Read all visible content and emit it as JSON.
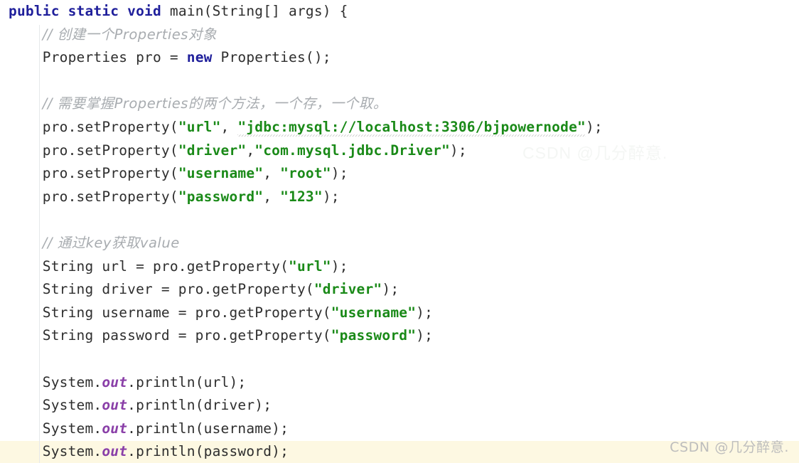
{
  "editor": {
    "language": "java",
    "background_color": "#ffffff",
    "highlight_color": "#fdf8e2",
    "indent_guide_color": "#e6e8ea",
    "colors": {
      "keyword": "#1f1f9b",
      "string": "#1a8a18",
      "comment": "#a8acb0",
      "static_field": "#8a3fa8",
      "plain_text": "#2e2e2e",
      "squiggle": "#cfcfcf"
    },
    "highlighted_line_number": 18
  },
  "code_lines": [
    {
      "id": "line-1",
      "highlighted": false,
      "tokens": [
        {
          "cls": "kw",
          "text": "public static void "
        },
        {
          "cls": "plain",
          "text": "main(String[] args) {"
        }
      ]
    },
    {
      "id": "line-2",
      "highlighted": false,
      "tokens": [
        {
          "cls": "plain",
          "text": "    "
        },
        {
          "cls": "cmt",
          "text": "// 创建一个Properties对象"
        }
      ]
    },
    {
      "id": "line-3",
      "highlighted": false,
      "tokens": [
        {
          "cls": "plain",
          "text": "    Properties pro = "
        },
        {
          "cls": "kw",
          "text": "new"
        },
        {
          "cls": "plain",
          "text": " Properties();"
        }
      ]
    },
    {
      "id": "line-4",
      "highlighted": false,
      "tokens": []
    },
    {
      "id": "line-5",
      "highlighted": false,
      "tokens": [
        {
          "cls": "plain",
          "text": "    "
        },
        {
          "cls": "cmt",
          "text": "// 需要掌握Properties的两个方法，一个存，一个取。"
        }
      ]
    },
    {
      "id": "line-6",
      "highlighted": false,
      "tokens": [
        {
          "cls": "plain",
          "text": "    pro.setProperty("
        },
        {
          "cls": "str",
          "text": "\"url\""
        },
        {
          "cls": "plain",
          "text": ", "
        },
        {
          "cls": "str squig",
          "text": "\"jdbc:mysql://localhost:3306/bjpowernode\""
        },
        {
          "cls": "plain",
          "text": ");"
        }
      ]
    },
    {
      "id": "line-7",
      "highlighted": false,
      "tokens": [
        {
          "cls": "plain",
          "text": "    pro.setProperty("
        },
        {
          "cls": "str",
          "text": "\"driver\""
        },
        {
          "cls": "plain",
          "text": ","
        },
        {
          "cls": "str",
          "text": "\"com.mysql.jdbc.Driver\""
        },
        {
          "cls": "plain",
          "text": ");"
        }
      ]
    },
    {
      "id": "line-8",
      "highlighted": false,
      "tokens": [
        {
          "cls": "plain",
          "text": "    pro.setProperty("
        },
        {
          "cls": "str",
          "text": "\"username\""
        },
        {
          "cls": "plain",
          "text": ", "
        },
        {
          "cls": "str",
          "text": "\"root\""
        },
        {
          "cls": "plain",
          "text": ");"
        }
      ]
    },
    {
      "id": "line-9",
      "highlighted": false,
      "tokens": [
        {
          "cls": "plain",
          "text": "    pro.setProperty("
        },
        {
          "cls": "str",
          "text": "\"password\""
        },
        {
          "cls": "plain",
          "text": ", "
        },
        {
          "cls": "str",
          "text": "\"123\""
        },
        {
          "cls": "plain",
          "text": ");"
        }
      ]
    },
    {
      "id": "line-10",
      "highlighted": false,
      "tokens": []
    },
    {
      "id": "line-11",
      "highlighted": false,
      "tokens": [
        {
          "cls": "plain",
          "text": "    "
        },
        {
          "cls": "cmt",
          "text": "// 通过key获取value"
        }
      ]
    },
    {
      "id": "line-12",
      "highlighted": false,
      "tokens": [
        {
          "cls": "plain",
          "text": "    String url = pro.getProperty("
        },
        {
          "cls": "str",
          "text": "\"url\""
        },
        {
          "cls": "plain",
          "text": ");"
        }
      ]
    },
    {
      "id": "line-13",
      "highlighted": false,
      "tokens": [
        {
          "cls": "plain",
          "text": "    String driver = pro.getProperty("
        },
        {
          "cls": "str",
          "text": "\"driver\""
        },
        {
          "cls": "plain",
          "text": ");"
        }
      ]
    },
    {
      "id": "line-14",
      "highlighted": false,
      "tokens": [
        {
          "cls": "plain",
          "text": "    String username = pro.getProperty("
        },
        {
          "cls": "str",
          "text": "\"username\""
        },
        {
          "cls": "plain",
          "text": ");"
        }
      ]
    },
    {
      "id": "line-15",
      "highlighted": false,
      "tokens": [
        {
          "cls": "plain",
          "text": "    String password = pro.getProperty("
        },
        {
          "cls": "str",
          "text": "\"password\""
        },
        {
          "cls": "plain",
          "text": ");"
        }
      ]
    },
    {
      "id": "line-16",
      "highlighted": false,
      "tokens": []
    },
    {
      "id": "line-17",
      "highlighted": false,
      "tokens": [
        {
          "cls": "plain",
          "text": "    System."
        },
        {
          "cls": "field",
          "text": "out"
        },
        {
          "cls": "plain",
          "text": ".println(url);"
        }
      ]
    },
    {
      "id": "line-18",
      "highlighted": false,
      "tokens": [
        {
          "cls": "plain",
          "text": "    System."
        },
        {
          "cls": "field",
          "text": "out"
        },
        {
          "cls": "plain",
          "text": ".println(driver);"
        }
      ]
    },
    {
      "id": "line-19",
      "highlighted": false,
      "tokens": [
        {
          "cls": "plain",
          "text": "    System."
        },
        {
          "cls": "field",
          "text": "out"
        },
        {
          "cls": "plain",
          "text": ".println(username);"
        }
      ]
    },
    {
      "id": "line-20",
      "highlighted": true,
      "tokens": [
        {
          "cls": "plain",
          "text": "    System."
        },
        {
          "cls": "field",
          "text": "out"
        },
        {
          "cls": "plain",
          "text": ".println(password);"
        }
      ]
    }
  ],
  "watermark": {
    "text": "CSDN @几分醉意.",
    "color": "#bdbdbd"
  },
  "faint_watermark": {
    "text": "CSDN @几分醉意."
  }
}
